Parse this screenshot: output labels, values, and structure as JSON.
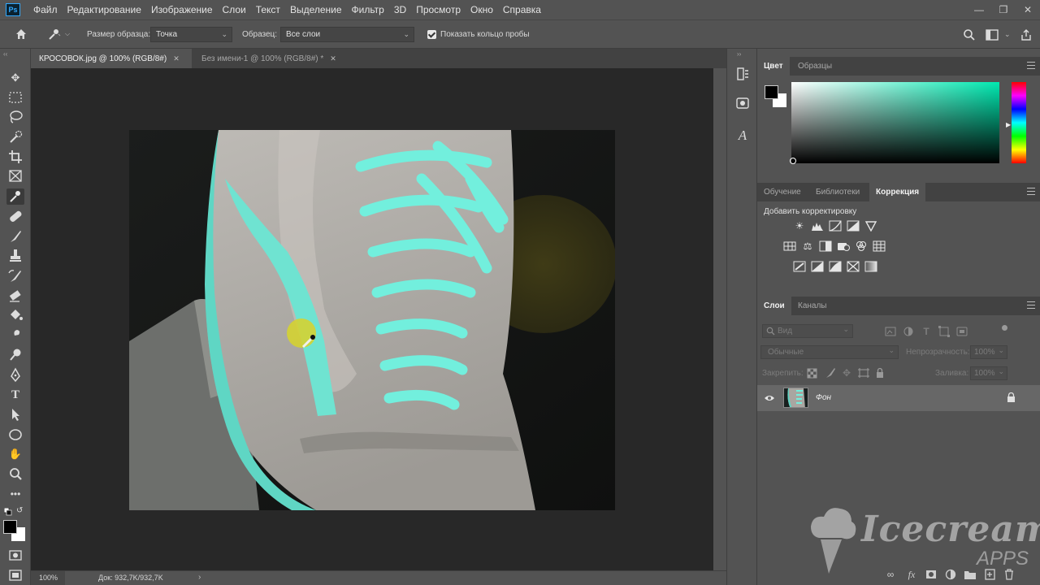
{
  "app": {
    "logo_text": "Ps"
  },
  "menu": [
    "Файл",
    "Редактирование",
    "Изображение",
    "Слои",
    "Текст",
    "Выделение",
    "Фильтр",
    "3D",
    "Просмотр",
    "Окно",
    "Справка"
  ],
  "options": {
    "sample_size_label": "Размер образца:",
    "sample_size_value": "Точка",
    "sample_label": "Образец:",
    "sample_value": "Все слои",
    "show_ring_label": "Показать кольцо пробы"
  },
  "tabs": [
    {
      "label": "КРОСОВОК.jpg @ 100% (RGB/8#)",
      "active": true
    },
    {
      "label": "Без имени-1 @ 100% (RGB/8#) *",
      "active": false
    }
  ],
  "status": {
    "zoom": "100%",
    "doc": "Док: 932,7K/932,7K"
  },
  "color_panel": {
    "tabs": [
      "Цвет",
      "Образцы"
    ],
    "foreground": "#000000",
    "background": "#ffffff",
    "hue_color": "#00e8b0"
  },
  "adjust_panel": {
    "tabs": [
      "Обучение",
      "Библиотеки",
      "Коррекция"
    ],
    "add_label": "Добавить корректировку"
  },
  "layers_panel": {
    "tabs": [
      "Слои",
      "Каналы"
    ],
    "filter_placeholder": "Вид",
    "blend_mode": "Обычные",
    "opacity_label": "Непрозрачность:",
    "opacity_value": "100%",
    "lock_label": "Закрепить:",
    "fill_label": "Заливка:",
    "fill_value": "100%",
    "layers": [
      {
        "name": "Фон",
        "locked": true,
        "visible": true
      }
    ]
  },
  "watermark": {
    "brand": "Icecream",
    "sub": "APPS"
  }
}
